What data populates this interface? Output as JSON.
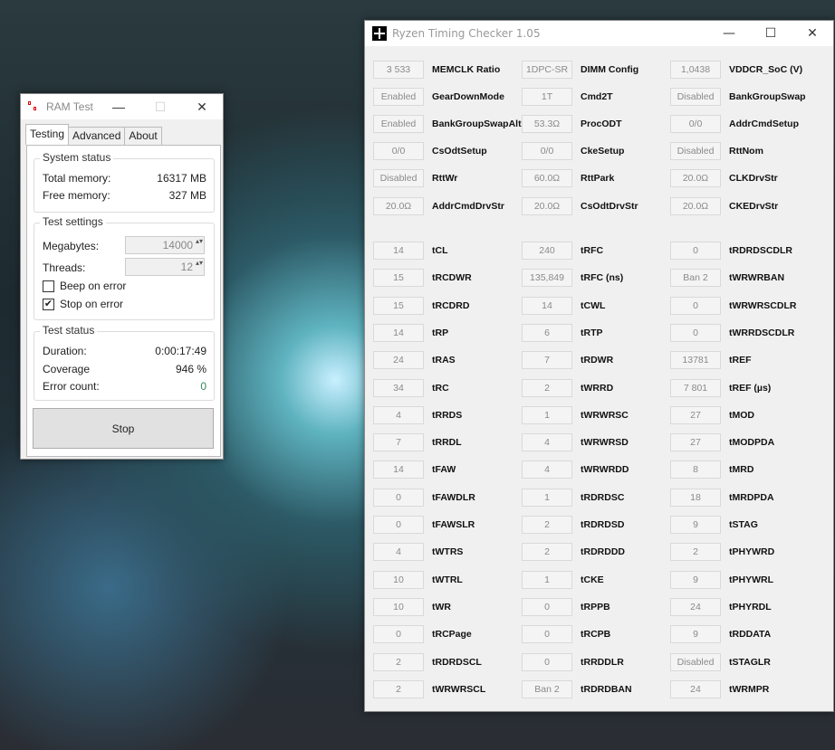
{
  "ram_test": {
    "title": "RAM Test",
    "tabs": [
      "Testing",
      "Advanced",
      "About"
    ],
    "system_status": {
      "heading": "System status",
      "total_label": "Total memory:",
      "total_value": "16317 MB",
      "free_label": "Free memory:",
      "free_value": "327 MB"
    },
    "test_settings": {
      "heading": "Test settings",
      "megabytes_label": "Megabytes:",
      "megabytes_value": "14000",
      "threads_label": "Threads:",
      "threads_value": "12",
      "beep_label": "Beep on error",
      "beep_checked": false,
      "stop_label": "Stop on error",
      "stop_checked": true
    },
    "test_status": {
      "heading": "Test status",
      "duration_label": "Duration:",
      "duration_value": "0:00:17:49",
      "coverage_label": "Coverage",
      "coverage_value": "946 %",
      "errors_label": "Error count:",
      "errors_value": "0",
      "error_color": "#2e8b57"
    },
    "stop_button": "Stop"
  },
  "rtc": {
    "title": "Ryzen Timing Checker 1.05",
    "config": [
      [
        [
          "3 533",
          "MEMCLK Ratio"
        ],
        [
          "1DPC-SR",
          "DIMM Config"
        ],
        [
          "1,0438",
          "VDDCR_SoC (V)"
        ]
      ],
      [
        [
          "Enabled",
          "GearDownMode"
        ],
        [
          "1T",
          "Cmd2T"
        ],
        [
          "Disabled",
          "BankGroupSwap"
        ]
      ],
      [
        [
          "Enabled",
          "BankGroupSwapAlt"
        ],
        [
          "53.3Ω",
          "ProcODT"
        ],
        [
          "0/0",
          "AddrCmdSetup"
        ]
      ],
      [
        [
          "0/0",
          "CsOdtSetup"
        ],
        [
          "0/0",
          "CkeSetup"
        ],
        [
          "Disabled",
          "RttNom"
        ]
      ],
      [
        [
          "Disabled",
          "RttWr"
        ],
        [
          "60.0Ω",
          "RttPark"
        ],
        [
          "20.0Ω",
          "CLKDrvStr"
        ]
      ],
      [
        [
          "20.0Ω",
          "AddrCmdDrvStr"
        ],
        [
          "20.0Ω",
          "CsOdtDrvStr"
        ],
        [
          "20.0Ω",
          "CKEDrvStr"
        ]
      ]
    ],
    "timings": [
      [
        [
          "14",
          "tCL"
        ],
        [
          "240",
          "tRFC"
        ],
        [
          "0",
          "tRDRDSCDLR"
        ]
      ],
      [
        [
          "15",
          "tRCDWR"
        ],
        [
          "135,849",
          "tRFC (ns)"
        ],
        [
          "Ban 2",
          "tWRWRBAN"
        ]
      ],
      [
        [
          "15",
          "tRCDRD"
        ],
        [
          "14",
          "tCWL"
        ],
        [
          "0",
          "tWRWRSCDLR"
        ]
      ],
      [
        [
          "14",
          "tRP"
        ],
        [
          "6",
          "tRTP"
        ],
        [
          "0",
          "tWRRDSCDLR"
        ]
      ],
      [
        [
          "24",
          "tRAS"
        ],
        [
          "7",
          "tRDWR"
        ],
        [
          "13781",
          "tREF"
        ]
      ],
      [
        [
          "34",
          "tRC"
        ],
        [
          "2",
          "tWRRD"
        ],
        [
          "7 801",
          "tREF (µs)"
        ]
      ],
      [
        [
          "4",
          "tRRDS"
        ],
        [
          "1",
          "tWRWRSC"
        ],
        [
          "27",
          "tMOD"
        ]
      ],
      [
        [
          "7",
          "tRRDL"
        ],
        [
          "4",
          "tWRWRSD"
        ],
        [
          "27",
          "tMODPDA"
        ]
      ],
      [
        [
          "14",
          "tFAW"
        ],
        [
          "4",
          "tWRWRDD"
        ],
        [
          "8",
          "tMRD"
        ]
      ],
      [
        [
          "0",
          "tFAWDLR"
        ],
        [
          "1",
          "tRDRDSC"
        ],
        [
          "18",
          "tMRDPDA"
        ]
      ],
      [
        [
          "0",
          "tFAWSLR"
        ],
        [
          "2",
          "tRDRDSD"
        ],
        [
          "9",
          "tSTAG"
        ]
      ],
      [
        [
          "4",
          "tWTRS"
        ],
        [
          "2",
          "tRDRDDD"
        ],
        [
          "2",
          "tPHYWRD"
        ]
      ],
      [
        [
          "10",
          "tWTRL"
        ],
        [
          "1",
          "tCKE"
        ],
        [
          "9",
          "tPHYWRL"
        ]
      ],
      [
        [
          "10",
          "tWR"
        ],
        [
          "0",
          "tRPPB"
        ],
        [
          "24",
          "tPHYRDL"
        ]
      ],
      [
        [
          "0",
          "tRCPage"
        ],
        [
          "0",
          "tRCPB"
        ],
        [
          "9",
          "tRDDATA"
        ]
      ],
      [
        [
          "2",
          "tRDRDSCL"
        ],
        [
          "0",
          "tRRDDLR"
        ],
        [
          "Disabled",
          "tSTAGLR"
        ]
      ],
      [
        [
          "2",
          "tWRWRSCL"
        ],
        [
          "Ban 2",
          "tRDRDBAN"
        ],
        [
          "24",
          "tWRMPR"
        ]
      ]
    ]
  }
}
